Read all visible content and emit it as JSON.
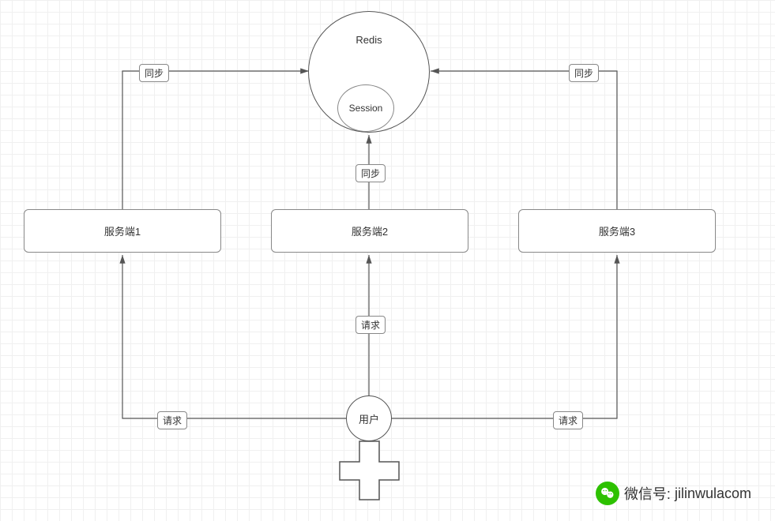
{
  "nodes": {
    "redis": {
      "label": "Redis"
    },
    "session": {
      "label": "Session"
    },
    "server1": {
      "label": "服务端1"
    },
    "server2": {
      "label": "服务端2"
    },
    "server3": {
      "label": "服务端3"
    },
    "user": {
      "label": "用户"
    }
  },
  "edges": {
    "sync1": {
      "label": "同步"
    },
    "sync2": {
      "label": "同步"
    },
    "sync3": {
      "label": "同步"
    },
    "req1": {
      "label": "请求"
    },
    "req2": {
      "label": "请求"
    },
    "req3": {
      "label": "请求"
    }
  },
  "watermark": {
    "label_prefix": "微信号:",
    "value": "jilinwulacom"
  }
}
